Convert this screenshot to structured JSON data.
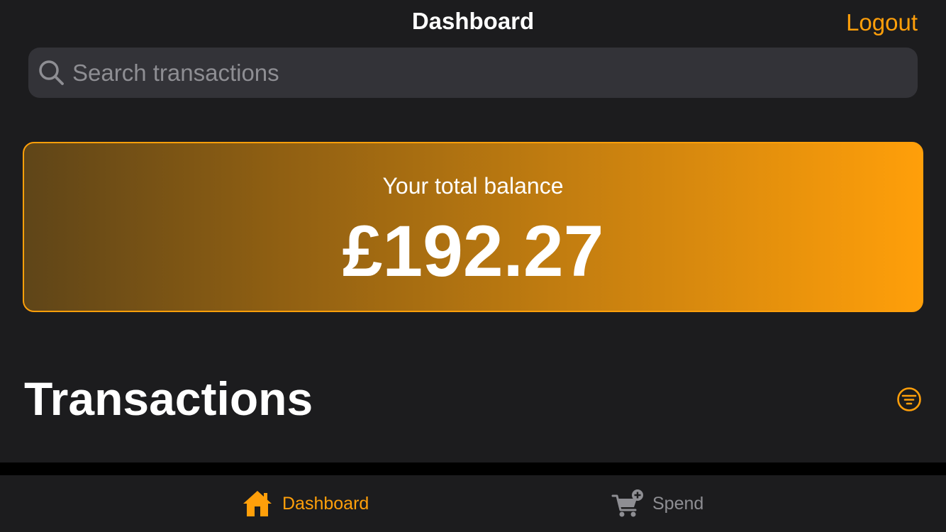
{
  "nav": {
    "title": "Dashboard",
    "logout_label": "Logout"
  },
  "search": {
    "placeholder": "Search transactions",
    "value": ""
  },
  "balance": {
    "label": "Your total balance",
    "amount": "£192.27"
  },
  "transactions": {
    "title": "Transactions"
  },
  "tabs": [
    {
      "label": "Dashboard",
      "icon": "home-icon",
      "active": true
    },
    {
      "label": "Spend",
      "icon": "cart-add-icon",
      "active": false
    }
  ],
  "colors": {
    "accent": "#ff9f0a",
    "background": "#1c1c1e",
    "search_bg": "#333338",
    "inactive": "#8e8e93"
  }
}
